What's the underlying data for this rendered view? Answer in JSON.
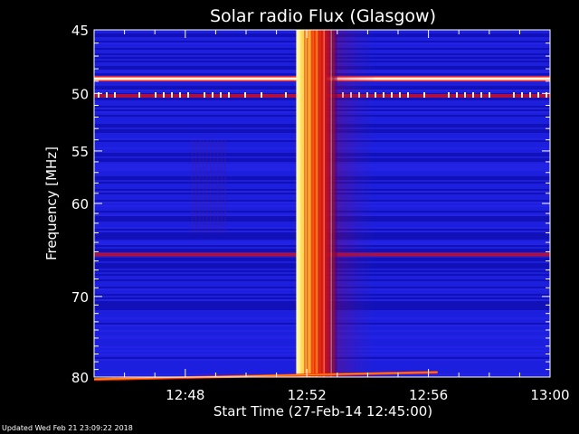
{
  "footer": {
    "updated_text": "Updated Wed Feb 21 23:09:22 2018"
  },
  "chart_data": {
    "type": "heatmap",
    "title": "Solar radio Flux (Glasgow)",
    "xlabel": "Start Time (27-Feb-14 12:45:00)",
    "ylabel": "Frequency [MHz]",
    "x_range_minutes": [
      0,
      15
    ],
    "y_range_mhz": [
      45,
      80
    ],
    "y_reversed": true,
    "y_scale": "log",
    "x_ticks": [
      {
        "minute": 3,
        "label": "12:48"
      },
      {
        "minute": 7,
        "label": "12:52"
      },
      {
        "minute": 11,
        "label": "12:56"
      },
      {
        "minute": 15,
        "label": "13:00"
      }
    ],
    "y_ticks": [
      {
        "mhz": 45,
        "label": "45"
      },
      {
        "mhz": 50,
        "label": "50"
      },
      {
        "mhz": 55,
        "label": "55"
      },
      {
        "mhz": 60,
        "label": "60"
      },
      {
        "mhz": 70,
        "label": "70"
      },
      {
        "mhz": 80,
        "label": "80"
      }
    ],
    "background_color": "#1b1bd9",
    "colors": {
      "low": "#0a0a9a",
      "mid": "#1e22e0",
      "band": "#b01040",
      "hot": "#ff3000",
      "hotter": "#ff9a20",
      "peak": "#fff8a0"
    },
    "burst": {
      "start_minute": 6.65,
      "core_end_minute": 7.0,
      "end_minute": 8.0,
      "freq_range_mhz": [
        45,
        80
      ]
    },
    "rfi_bands_mhz": [
      48.8,
      50.2,
      65.3
    ],
    "low_freq_drift": {
      "start_minute": 0.0,
      "end_minute": 11.3,
      "freq_start_mhz": 79.9,
      "freq_end_mhz": 79.2
    }
  }
}
